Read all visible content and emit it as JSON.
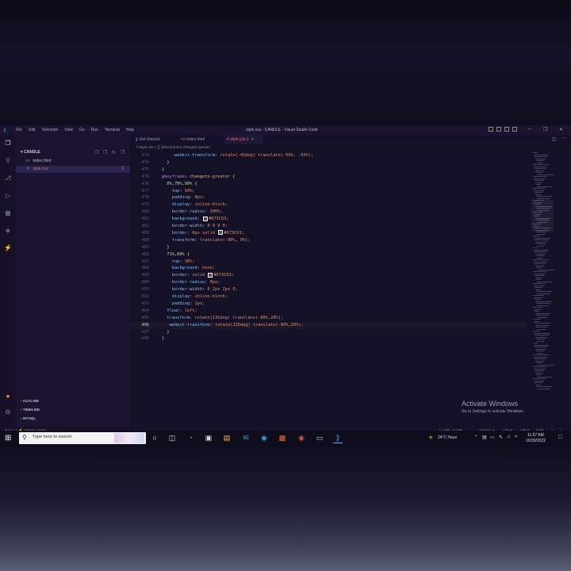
{
  "window": {
    "title": "style.css - CANDLE - Visual Studio Code",
    "menu": [
      "File",
      "Edit",
      "Selection",
      "View",
      "Go",
      "Run",
      "Terminal",
      "Help"
    ]
  },
  "sidebar": {
    "folder": "CANDLE",
    "files": [
      {
        "icon": "<>",
        "name": "index.html",
        "badge": ""
      },
      {
        "icon": "#",
        "name": "style.css",
        "badge": "2",
        "selected": true
      }
    ],
    "sections": [
      "OUTLINE",
      "TIMELINE",
      "MYSQL"
    ]
  },
  "tabs": [
    {
      "icon": "❯",
      "label": "Get Started"
    },
    {
      "icon": "<>",
      "label": "index.html"
    },
    {
      "icon": "#",
      "label": "style.css 2",
      "close": "×",
      "active": true
    }
  ],
  "breadcrumb": "# style.css > {} @keyframes changeto-greater",
  "editor": {
    "lines": [
      {
        "n": "473",
        "code": "    -webkit-transform: rotate(-45deg) translate(-50%, -65%);"
      },
      {
        "n": "474",
        "code": "  }"
      },
      {
        "n": "475",
        "code": "}"
      },
      {
        "n": "476",
        "code": "@keyframes changeto-greater {"
      },
      {
        "n": "476",
        "code": "  0%,70%,90% {"
      },
      {
        "n": "477",
        "code": "    top: 50%;"
      },
      {
        "n": "478",
        "code": "    padding: 0px;"
      },
      {
        "n": "479",
        "code": "    display: inline-block;"
      },
      {
        "n": "480",
        "code": "    border-radius: 100%;"
      },
      {
        "n": "481",
        "code": "    background: ■#673C63;"
      },
      {
        "n": "482",
        "code": "    border-width: 0 0 0 0;"
      },
      {
        "n": "483",
        "code": "    border: 0px solid ■#673C63;"
      },
      {
        "n": "484",
        "code": "    transform: translate(-80%, 0%);"
      },
      {
        "n": "485",
        "code": "  }"
      },
      {
        "n": "486",
        "code": "  71%,89% {"
      },
      {
        "n": "487",
        "code": "    top: 30%;"
      },
      {
        "n": "488",
        "code": "    background: none;"
      },
      {
        "n": "489",
        "code": "    border: solid ■#673C63;"
      },
      {
        "n": "490",
        "code": "    border-radius: 0px;"
      },
      {
        "n": "491",
        "code": "    border-width: 0 2px 2px 0;"
      },
      {
        "n": "492",
        "code": "    display: inline-block;"
      },
      {
        "n": "493",
        "code": "    padding: 1px;"
      },
      {
        "n": "494",
        "code": "  float: left;"
      },
      {
        "n": "495",
        "code": "  transform: rotate(135deg) translate(-80%,20%);"
      },
      {
        "n": "496",
        "code": "  -webkit-transform: rotate(135deg) translate(-80%,20%);"
      },
      {
        "n": "497",
        "code": "  }"
      },
      {
        "n": "498",
        "code": "}"
      }
    ]
  },
  "watermark": {
    "heading": "Activate Windows",
    "sub": "Go to Settings to activate Windows."
  },
  "statusbar": {
    "left": "⊗ 0 ⚠ 1   ⚡ tabnine starter",
    "position": "Ln 496, Col 59",
    "spaces": "Spaces: 4",
    "encoding": "UTF-8",
    "eol": "CRLF",
    "language": "CSS"
  },
  "taskbar": {
    "search_placeholder": "Type here to search",
    "weather": "24°C  Haze",
    "time": "11:57 AM",
    "date": "10/30/2022"
  },
  "colors": {
    "accent": "#3b9be8",
    "swatch": "#673c63"
  }
}
